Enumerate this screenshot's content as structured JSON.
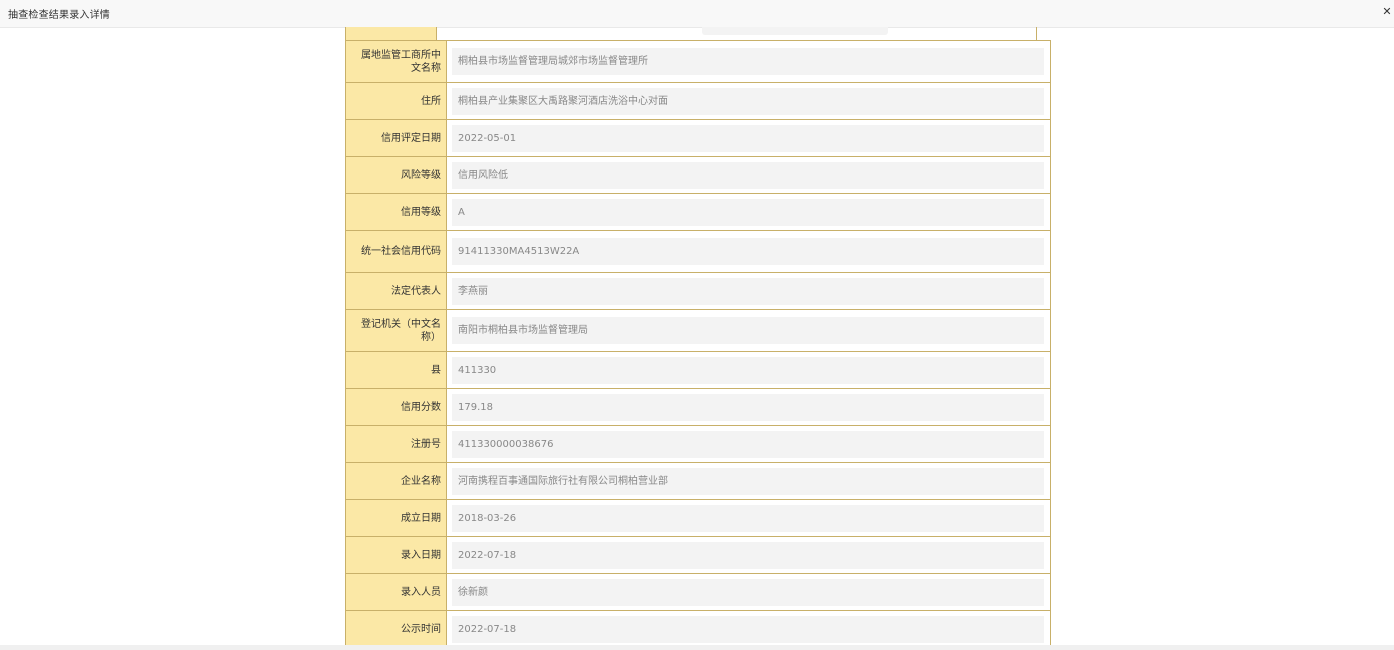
{
  "window": {
    "title": "抽查检查结果录入详情",
    "close_icon": "close-icon"
  },
  "rows": [
    {
      "label": "属地监管工商所中文名称",
      "value": "桐柏县市场监督管理局城郊市场监督管理所"
    },
    {
      "label": "住所",
      "value": "桐柏县产业集聚区大禹路聚河酒店洗浴中心对面"
    },
    {
      "label": "信用评定日期",
      "value": "2022-05-01"
    },
    {
      "label": "风险等级",
      "value": "信用风险低"
    },
    {
      "label": "信用等级",
      "value": "A"
    },
    {
      "label": "统一社会信用代码",
      "value": "91411330MA4513W22A"
    },
    {
      "label": "法定代表人",
      "value": "李燕丽"
    },
    {
      "label": "登记机关（中文名称）",
      "value": "南阳市桐柏县市场监督管理局"
    },
    {
      "label": "县",
      "value": "411330"
    },
    {
      "label": "信用分数",
      "value": "179.18"
    },
    {
      "label": "注册号",
      "value": "411330000038676"
    },
    {
      "label": "企业名称",
      "value": "河南携程百事通国际旅行社有限公司桐柏营业部"
    },
    {
      "label": "成立日期",
      "value": "2018-03-26"
    },
    {
      "label": "录入日期",
      "value": "2022-07-18"
    },
    {
      "label": "录入人员",
      "value": "徐新颜"
    },
    {
      "label": "公示时间",
      "value": "2022-07-18"
    }
  ]
}
